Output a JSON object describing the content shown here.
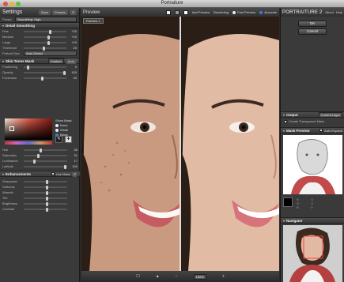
{
  "window": {
    "title": "Portraiture"
  },
  "settings": {
    "title": "Settings",
    "buttons": {
      "save": "Save",
      "preset": "Presets",
      "reset": "↺"
    },
    "preset": {
      "label": "Preset",
      "value": "Smoothing: High"
    }
  },
  "detail_smoothing": {
    "title": "Detail Smoothing",
    "sliders": [
      {
        "label": "Fine",
        "value": "+20",
        "level": 0.6
      },
      {
        "label": "Medium",
        "value": "+10",
        "level": 0.55
      },
      {
        "label": "Large",
        "value": "+10",
        "level": 0.55
      },
      {
        "label": "Threshold",
        "value": "20",
        "level": 0.45
      }
    ],
    "portrait_size": {
      "label": "Portrait Size",
      "value": "Auto Detect"
    }
  },
  "skin_tones": {
    "title": "Skin Tones Mask",
    "mode": "Custom",
    "auto": "Auto",
    "sliders": [
      {
        "label": "Feathering",
        "value": "0",
        "level": 0.05
      },
      {
        "label": "Opacity",
        "value": "100",
        "level": 0.95
      },
      {
        "label": "Fuzziness",
        "value": "40",
        "level": 0.4
      }
    ],
    "show_mask_label": "Show Mask",
    "show_mask_options": [
      "None",
      "White",
      "Black"
    ],
    "color_sliders": [
      {
        "label": "Hue",
        "value": "36",
        "level": 0.35
      },
      {
        "label": "Saturation",
        "value": "31",
        "level": 0.3
      },
      {
        "label": "Luminance",
        "value": "17",
        "level": 0.2
      },
      {
        "label": "Latitude",
        "value": "100",
        "level": 0.95
      }
    ]
  },
  "enhancements": {
    "title": "Enhancements",
    "use_mask": "Use Mask",
    "sliders": [
      "Sharpness",
      "Softness",
      "Warmth",
      "Tint",
      "Brightness",
      "Contrast"
    ]
  },
  "preview": {
    "title": "Preview",
    "tab": "Preview 1",
    "add_preview": "Add Preview",
    "bracketing": "Bracketing",
    "fast_preview": "Fast Preview",
    "accurate": "Accurate",
    "zoom": "100%"
  },
  "right": {
    "logo": "PORTRAITURE 2",
    "about": "About",
    "help": "Help",
    "ok": "OK",
    "cancel": "Cancel",
    "output": {
      "title": "Output",
      "value": "Current Layer"
    },
    "create_mask": "Create Transparent Mask",
    "mask_preview": {
      "title": "Mask Preview",
      "auto_expand": "Auto Expand"
    },
    "navigator": {
      "title": "Navigator"
    }
  },
  "colors": {
    "panel": "#3a3a3a",
    "accent": "#d9d9d9"
  }
}
